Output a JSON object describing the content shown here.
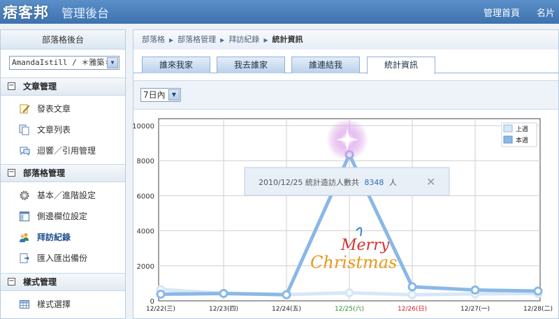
{
  "header": {
    "logo": "痞客邦",
    "subtitle": "管理後台",
    "links": [
      "管理首頁",
      "名片"
    ]
  },
  "sidebar": {
    "title": "部落格後台",
    "blog_select": "AmandaIstill / ＊雅築＊",
    "sections": [
      {
        "label": "文章管理",
        "items": [
          {
            "label": "發表文章",
            "icon": "pencil-icon"
          },
          {
            "label": "文章列表",
            "icon": "documents-icon"
          },
          {
            "label": "迴響／引用管理",
            "icon": "speech-bubble-icon"
          }
        ]
      },
      {
        "label": "部落格管理",
        "items": [
          {
            "label": "基本／進階設定",
            "icon": "gear-icon"
          },
          {
            "label": "側邊欄位設定",
            "icon": "layout-icon"
          },
          {
            "label": "拜訪紀錄",
            "icon": "users-icon",
            "active": true
          },
          {
            "label": "匯入匯出備份",
            "icon": "import-export-icon"
          }
        ]
      },
      {
        "label": "樣式管理",
        "items": [
          {
            "label": "樣式選擇",
            "icon": "grid-icon"
          }
        ]
      }
    ]
  },
  "breadcrumb": [
    "部落格",
    "部落格管理",
    "拜訪紀錄",
    "統計資訊"
  ],
  "tabs": [
    {
      "label": "誰來我家",
      "selected": false
    },
    {
      "label": "我去誰家",
      "selected": false
    },
    {
      "label": "誰連結我",
      "selected": false
    },
    {
      "label": "統計資訊",
      "selected": true
    }
  ],
  "range_select": "7日內",
  "tooltip": {
    "prefix": "2010/12/25 統計造訪人數共",
    "value": "8348",
    "suffix": "人"
  },
  "overlay": {
    "line1": "Merry",
    "line2": "Christmas"
  },
  "colors": {
    "header_bg": "#4a80bf",
    "this_week": "#8ab8e6",
    "last_week": "#d6e7f7",
    "weekend_green": "#2a8a2a",
    "weekend_red": "#d02020",
    "accent_link": "#2a6fc2"
  },
  "chart_data": {
    "type": "line",
    "categories": [
      "12/22(三)",
      "12/23(四)",
      "12/24(五)",
      "12/25(六)",
      "12/26(日)",
      "12/27(一)",
      "12/28(二)"
    ],
    "category_colors": [
      "#222222",
      "#222222",
      "#222222",
      "#2a8a2a",
      "#d02020",
      "#222222",
      "#222222"
    ],
    "ylim": [
      0,
      10000
    ],
    "yticks": [
      "0",
      "2000",
      "4000",
      "6000",
      "8000",
      "10000"
    ],
    "ytick_values": [
      0,
      2000,
      4000,
      6000,
      8000,
      10000
    ],
    "series": [
      {
        "name": "上週",
        "values": [
          650,
          430,
          360,
          460,
          350,
          400,
          420
        ]
      },
      {
        "name": "本週",
        "values": [
          380,
          420,
          350,
          8348,
          800,
          620,
          560
        ]
      }
    ],
    "legend_position": "top-right",
    "grid": true
  }
}
